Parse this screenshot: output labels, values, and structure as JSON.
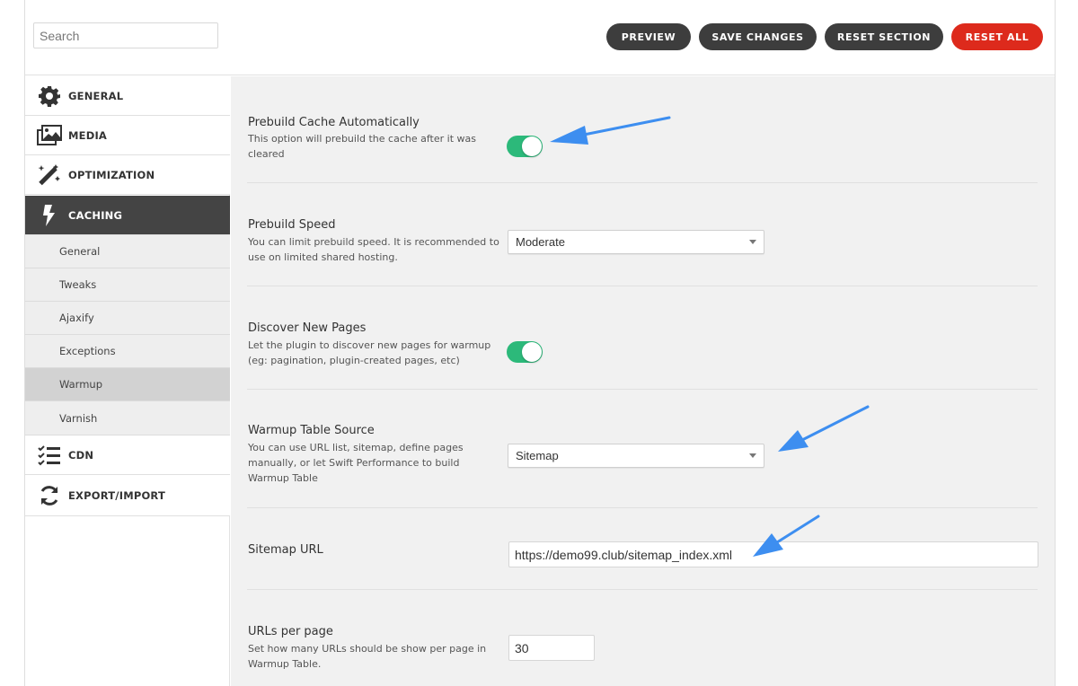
{
  "header": {
    "search_placeholder": "Search",
    "buttons": {
      "preview": "PREVIEW",
      "save": "SAVE CHANGES",
      "reset_section": "RESET SECTION",
      "reset_all": "RESET ALL"
    }
  },
  "sidebar": {
    "items": [
      {
        "label": "GENERAL",
        "icon": "gear-icon"
      },
      {
        "label": "MEDIA",
        "icon": "images-icon"
      },
      {
        "label": "OPTIMIZATION",
        "icon": "magic-wand-icon"
      },
      {
        "label": "CACHING",
        "icon": "lightning-icon",
        "active": true
      },
      {
        "label": "CDN",
        "icon": "checklist-icon"
      },
      {
        "label": "EXPORT/IMPORT",
        "icon": "refresh-icon"
      }
    ],
    "caching_subitems": [
      "General",
      "Tweaks",
      "Ajaxify",
      "Exceptions",
      "Warmup",
      "Varnish"
    ],
    "selected_subitem": "Warmup"
  },
  "settings": {
    "prebuild_cache": {
      "title": "Prebuild Cache Automatically",
      "description": "This option will prebuild the cache after it was cleared",
      "enabled": true
    },
    "prebuild_speed": {
      "title": "Prebuild Speed",
      "description": "You can limit prebuild speed. It is recommended to use on limited shared hosting.",
      "value": "Moderate"
    },
    "discover_pages": {
      "title": "Discover New Pages",
      "description": "Let the plugin to discover new pages for warmup (eg: pagination, plugin-created pages, etc)",
      "enabled": true
    },
    "warmup_source": {
      "title": "Warmup Table Source",
      "description": "You can use URL list, sitemap, define pages manually, or let Swift Performance to build Warmup Table",
      "value": "Sitemap"
    },
    "sitemap_url": {
      "title": "Sitemap URL",
      "value": "https://demo99.club/sitemap_index.xml"
    },
    "urls_per_page": {
      "title": "URLs per page",
      "description": "Set how many URLs should be show per page in Warmup Table.",
      "value": "30"
    }
  },
  "colors": {
    "accent_toggle": "#2cb97a",
    "reset_all": "#dd2a1c",
    "dark_button": "#3d3d3d",
    "annotation_arrow": "#3d8ef0"
  }
}
